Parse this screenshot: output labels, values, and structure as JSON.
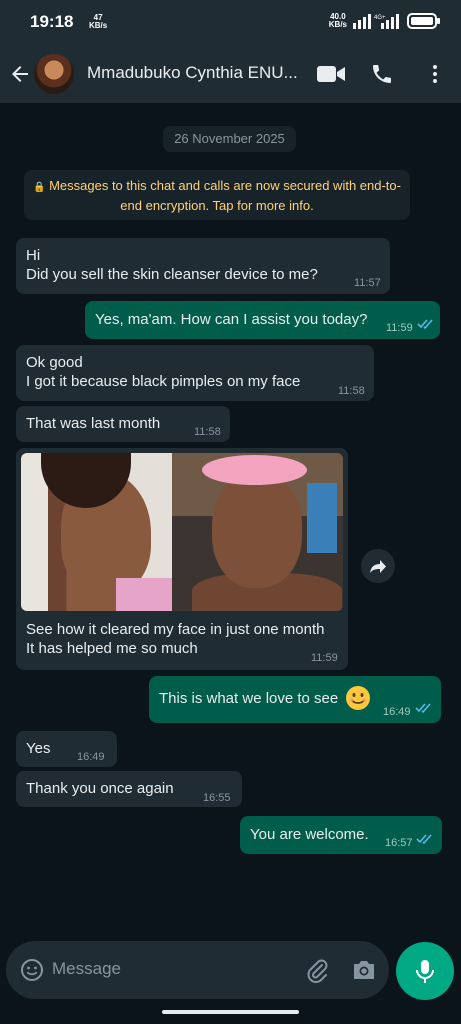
{
  "status_bar": {
    "time": "19:18",
    "kbs_value": "47",
    "kbs_unit": "KB/s",
    "net_value": "40.0",
    "net_unit": "KB/s"
  },
  "header": {
    "contact_name": "Mmadubuko Cynthia ENU..."
  },
  "chat": {
    "date_chip": "26 November 2025",
    "encryption_notice": "Messages to this chat and calls are now secured with end-to-end encryption. Tap for more info.",
    "messages": [
      {
        "dir": "in",
        "lines": [
          "Hi",
          "Did you sell the skin cleanser device to me?"
        ],
        "time": "11:57"
      },
      {
        "dir": "out",
        "lines": [
          "Yes, ma'am. How can I assist you today?"
        ],
        "time": "11:59"
      },
      {
        "dir": "in",
        "lines": [
          "Ok good",
          "I got it because black pimples on my face"
        ],
        "time": "11:58"
      },
      {
        "dir": "in",
        "lines": [
          "That was last month"
        ],
        "time": "11:58"
      },
      {
        "dir": "in",
        "lines": [
          "See how it cleared my face in just one month",
          "It has helped me so much"
        ],
        "time": "11:59"
      },
      {
        "dir": "out",
        "lines": [
          "This is what we love to see"
        ],
        "time": "16:49"
      },
      {
        "dir": "in",
        "lines": [
          "Yes"
        ],
        "time": "16:49"
      },
      {
        "dir": "in",
        "lines": [
          "Thank you once again"
        ],
        "time": "16:55"
      },
      {
        "dir": "out",
        "lines": [
          "You are welcome."
        ],
        "time": "16:57"
      }
    ]
  },
  "composer": {
    "placeholder": "Message"
  },
  "colors": {
    "accent": "#00a884",
    "outgoing_bubble": "#005c4b",
    "incoming_bubble": "#1f2c34",
    "read_ticks": "#53bdeb"
  }
}
